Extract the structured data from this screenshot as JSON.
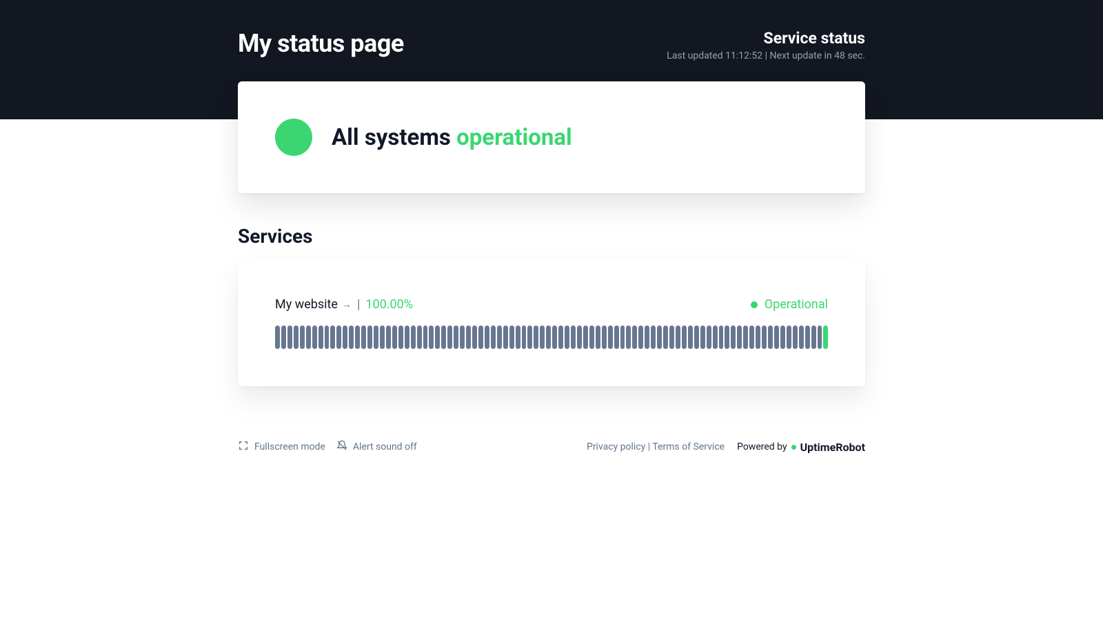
{
  "header": {
    "page_title": "My status page",
    "status_title": "Service status",
    "status_sub": "Last updated 11:12:52 | Next update in 48 sec."
  },
  "overall": {
    "text_prefix": "All systems ",
    "text_status": "operational"
  },
  "services_heading": "Services",
  "service": {
    "name": "My website",
    "uptime_pct": "100.00%",
    "pipe": "|",
    "status_label": "Operational",
    "bars_total": 90,
    "bars_last_green": 1
  },
  "footer": {
    "fullscreen": "Fullscreen mode",
    "alert_sound": "Alert sound off",
    "privacy": "Privacy policy",
    "links_sep": " | ",
    "tos": "Terms of Service",
    "powered_by": "Powered by",
    "brand": "UptimeRobot"
  }
}
